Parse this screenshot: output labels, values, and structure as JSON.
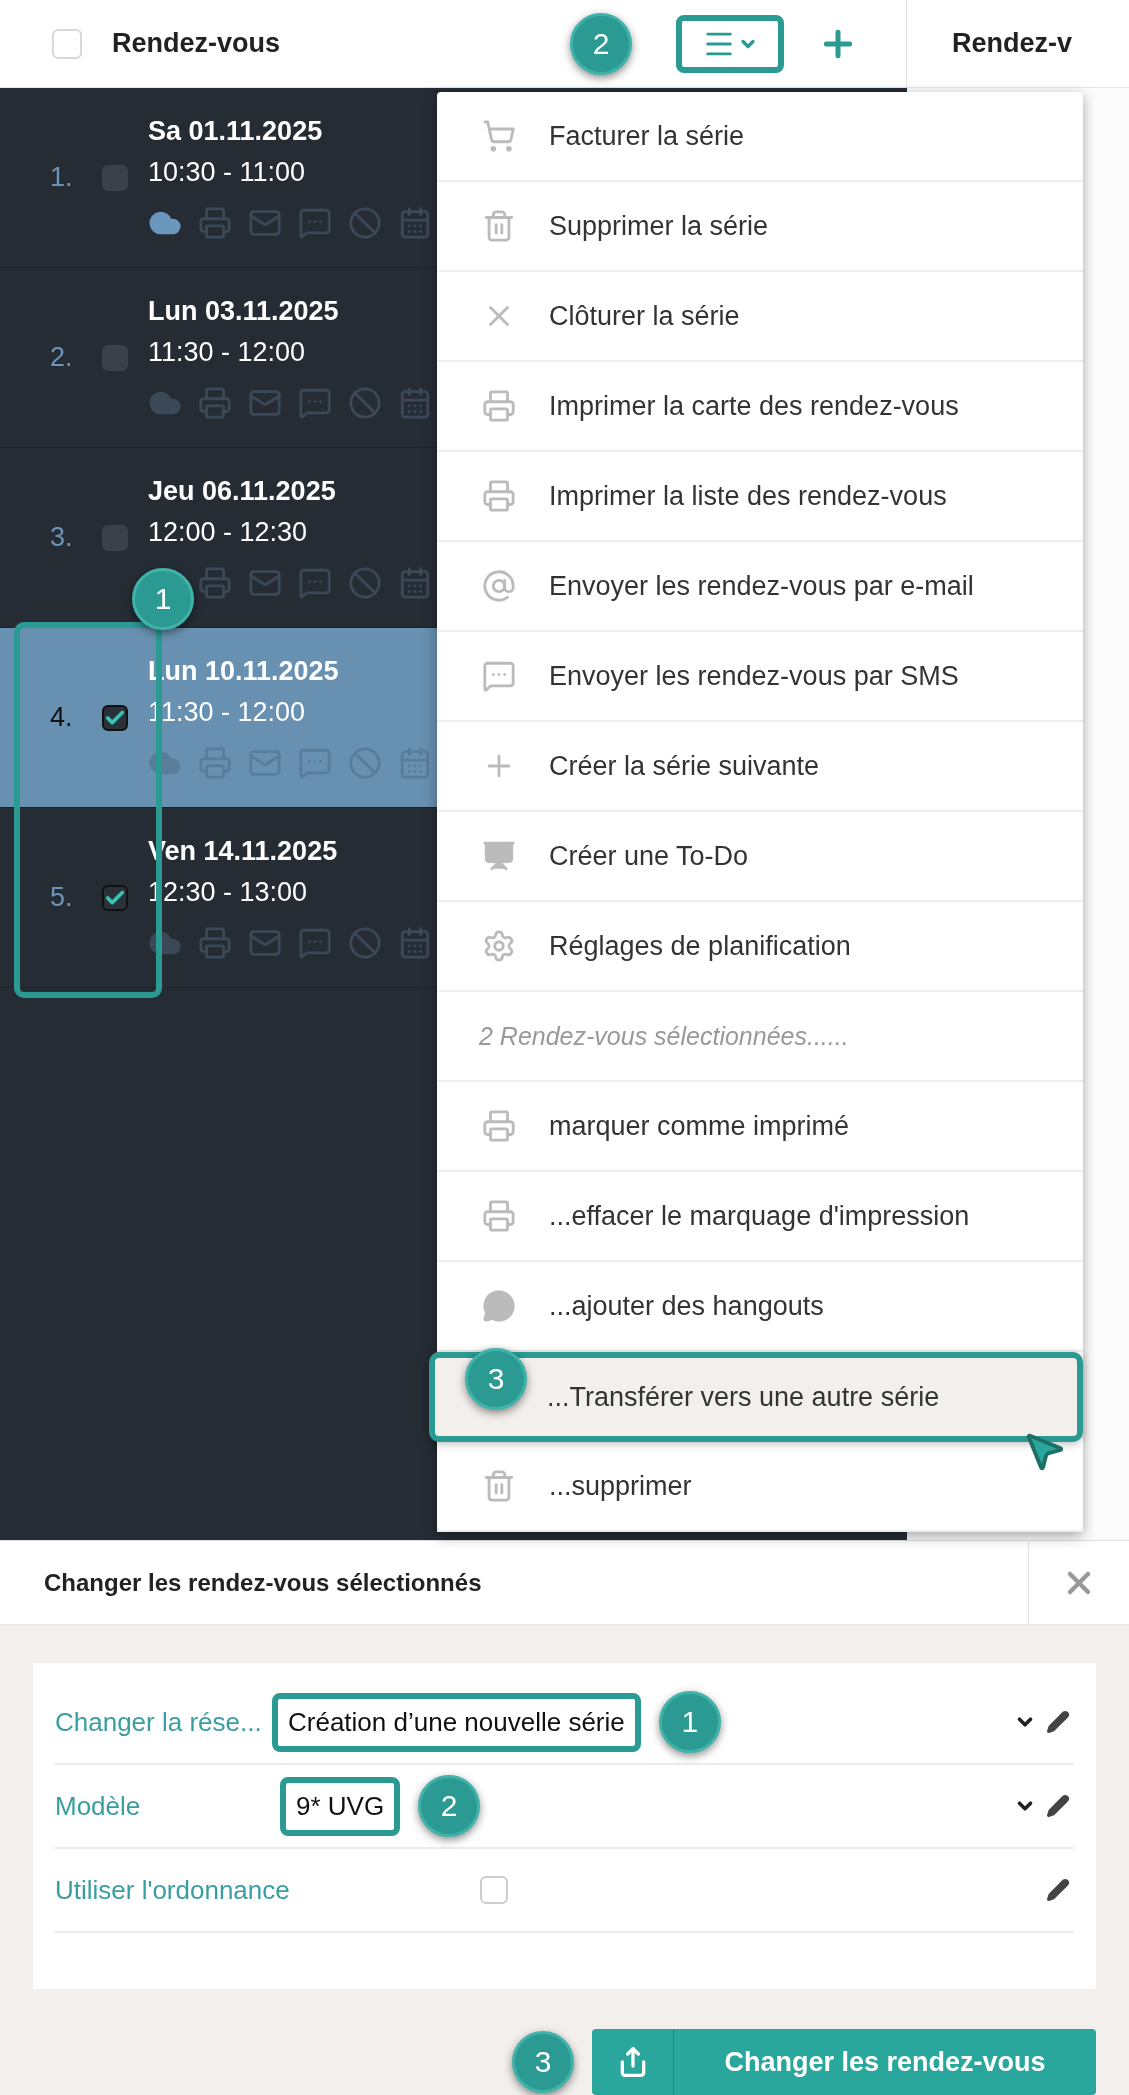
{
  "header": {
    "select_all_checked": false,
    "title": "Rendez-vous",
    "menu_highlighted": true,
    "menu_callout": "2",
    "second_column_title": "Rendez-v"
  },
  "appointments": [
    {
      "number": "1.",
      "date": "Sa 01.11.2025",
      "time": "10:30 - 11:00",
      "checked": false,
      "selected": false,
      "synced": true,
      "highlighted": false
    },
    {
      "number": "2.",
      "date": "Lun 03.11.2025",
      "time": "11:30 - 12:00",
      "checked": false,
      "selected": false,
      "synced": false,
      "highlighted": false
    },
    {
      "number": "3.",
      "date": "Jeu 06.11.2025",
      "time": "12:00 - 12:30",
      "checked": false,
      "selected": false,
      "highlighted": false
    },
    {
      "number": "4.",
      "date": "Lun 10.11.2025",
      "time": "11:30 - 12:00",
      "checked": true,
      "selected": true,
      "synced": false,
      "highlighted": true
    },
    {
      "number": "5.",
      "date": "Ven 14.11.2025",
      "time": "12:30 - 13:00",
      "checked": true,
      "selected": false,
      "synced": false,
      "highlighted": true
    }
  ],
  "appointments_callout": "1",
  "menu": {
    "items": [
      {
        "kind": "action",
        "label": "Facturer la série",
        "hovered": false,
        "highlighted": false
      },
      {
        "kind": "action",
        "label": "Supprimer la série",
        "hovered": false,
        "highlighted": false
      },
      {
        "kind": "action",
        "label": "Clôturer la série",
        "hovered": false,
        "highlighted": false
      },
      {
        "kind": "action",
        "label": "Imprimer la carte des rendez-vous",
        "hovered": false,
        "highlighted": false
      },
      {
        "kind": "action",
        "label": "Imprimer la liste des rendez-vous",
        "hovered": false,
        "highlighted": false
      },
      {
        "kind": "action",
        "label": "Envoyer les rendez-vous par e-mail",
        "hovered": false,
        "highlighted": false
      },
      {
        "kind": "action",
        "label": "Envoyer les rendez-vous par SMS",
        "hovered": false,
        "highlighted": false
      },
      {
        "kind": "action",
        "label": "Créer la série suivante",
        "hovered": false,
        "highlighted": false
      },
      {
        "kind": "action",
        "label": "Créer une To-Do",
        "hovered": false,
        "highlighted": false
      },
      {
        "kind": "action",
        "label": "Réglages de planification",
        "hovered": false,
        "highlighted": false
      },
      {
        "kind": "section",
        "label": "2 Rendez-vous sélectionnées......"
      },
      {
        "kind": "action",
        "label": "marquer comme imprimé",
        "hovered": false,
        "highlighted": false
      },
      {
        "kind": "action",
        "label": "...effacer le marquage d'impression",
        "hovered": false,
        "highlighted": false
      },
      {
        "kind": "action",
        "label": "...ajouter des hangouts",
        "hovered": false,
        "highlighted": false
      },
      {
        "kind": "action",
        "label": "...Transférer vers une autre série",
        "hovered": true,
        "highlighted": true,
        "callout": "3"
      },
      {
        "kind": "action",
        "label": "...supprimer",
        "hovered": false,
        "highlighted": false
      }
    ]
  },
  "dialog": {
    "title": "Changer les rendez-vous sélectionnés",
    "fields": [
      {
        "kind": "select",
        "label": "Changer la rése...",
        "value": "Création d’une nouvelle série",
        "highlighted": true,
        "callout": "1"
      },
      {
        "kind": "select",
        "label": "Modèle",
        "value": "9* UVG",
        "highlighted": true,
        "callout": "2"
      },
      {
        "kind": "checkbox",
        "label": "Utiliser l'ordonnance",
        "checked": false
      }
    ],
    "submit": {
      "label": "Changer les rendez-vous",
      "callout": "3"
    }
  }
}
